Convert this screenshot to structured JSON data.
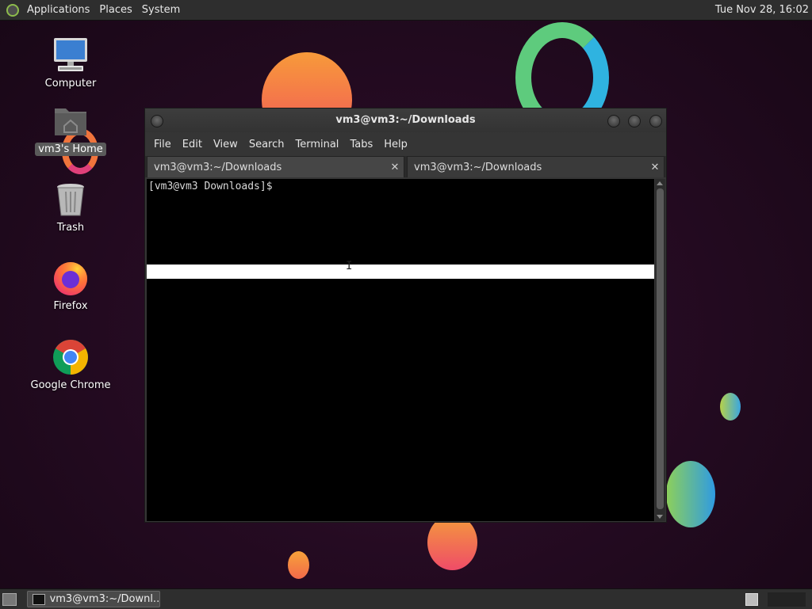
{
  "top_panel": {
    "menus": [
      "Applications",
      "Places",
      "System"
    ],
    "clock": "Tue Nov 28, 16:02"
  },
  "desktop_icons": [
    {
      "label": "Computer",
      "icon": "computer-icon"
    },
    {
      "label": "vm3's Home",
      "icon": "home-folder-icon",
      "selected": true
    },
    {
      "label": "Trash",
      "icon": "trash-icon"
    },
    {
      "label": "Firefox",
      "icon": "firefox-icon"
    },
    {
      "label": "Google Chrome",
      "icon": "chrome-icon"
    }
  ],
  "terminal": {
    "title": "vm3@vm3:~/Downloads",
    "menu": [
      "File",
      "Edit",
      "View",
      "Search",
      "Terminal",
      "Tabs",
      "Help"
    ],
    "tabs": [
      {
        "label": "vm3@vm3:~/Downloads",
        "active": true
      },
      {
        "label": "vm3@vm3:~/Downloads",
        "active": false
      }
    ],
    "close_glyph": "✕",
    "prompt": "[vm3@vm3 Downloads]$"
  },
  "taskbar": {
    "task_label": "vm3@vm3:~/Downl..."
  }
}
